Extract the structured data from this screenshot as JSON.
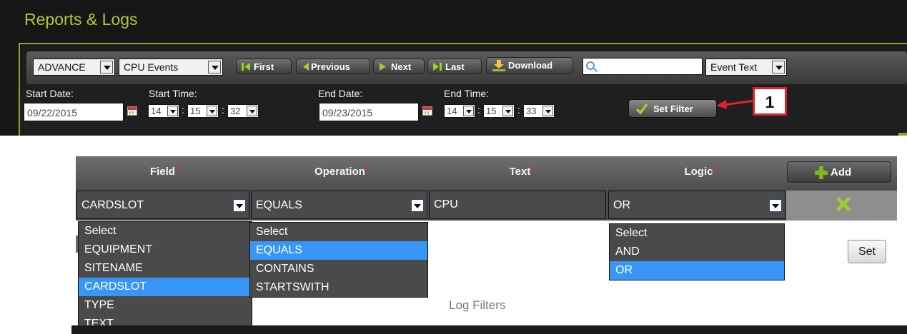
{
  "header": {
    "title": "Reports & Logs"
  },
  "toolbar": {
    "mode_select": "ADVANCE",
    "events_select": "CPU Events",
    "first": "First",
    "previous": "Previous",
    "next": "Next",
    "last": "Last",
    "download": "Download",
    "search_value": "",
    "search_field_select": "Event Text"
  },
  "filter": {
    "start_date_label": "Start Date:",
    "start_date": "09/22/2015",
    "start_time_label": "Start Time:",
    "start_hour": "14",
    "start_min": "15",
    "start_sec": "32",
    "end_date_label": "End Date:",
    "end_date": "09/23/2015",
    "end_time_label": "End Time:",
    "end_hour": "14",
    "end_min": "15",
    "end_sec": "33",
    "colon": ":",
    "set_filter": "Set Filter"
  },
  "callout": {
    "number": "1"
  },
  "builder": {
    "headers": {
      "field": "Field",
      "operation": "Operation",
      "text": "Text",
      "logic": "Logic",
      "required_mark": "*"
    },
    "add": "Add",
    "row": {
      "field": "CARDSLOT",
      "operation": "EQUALS",
      "text": "CPU",
      "logic": "OR"
    },
    "field_options": [
      "Select",
      "EQUIPMENT",
      "SITENAME",
      "CARDSLOT",
      "TYPE",
      "TEXT"
    ],
    "operation_options": [
      "Select",
      "EQUALS",
      "CONTAINS",
      "STARTSWITH"
    ],
    "logic_options": [
      "Select",
      "AND",
      "OR"
    ],
    "set": "Set",
    "footer": "Log Filters"
  },
  "colors": {
    "accent": "#b3c73a",
    "frame": "#8aa52a",
    "highlight": "#3796f6",
    "callout": "#e0202a"
  }
}
